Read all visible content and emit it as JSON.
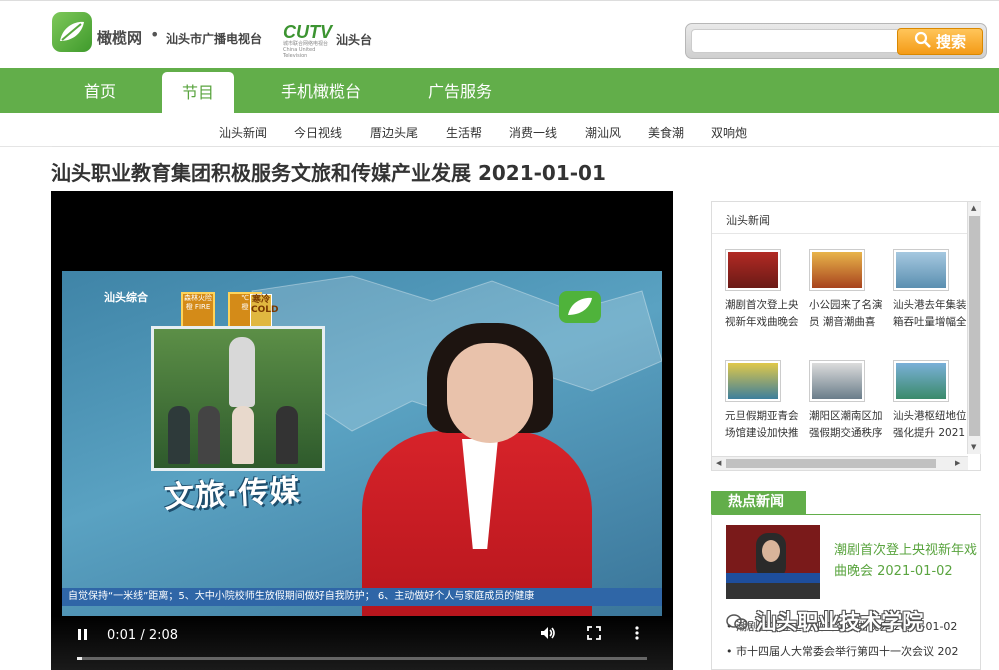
{
  "header": {
    "brand_name": "橄榄网",
    "brand_dot": "•",
    "station": "汕头市广播电视台",
    "cutv_logo": "CUTV",
    "cutv_sub": "城市联合网络电视台 China United Television",
    "cutv_city": "汕头台",
    "search_placeholder": "",
    "search_label": "搜索"
  },
  "nav": {
    "items": [
      {
        "label": "首页"
      },
      {
        "label": "节目"
      },
      {
        "label": "手机橄榄台"
      },
      {
        "label": "广告服务"
      }
    ],
    "active_index": 1
  },
  "subnav": {
    "items": [
      "汕头新闻",
      "今日视线",
      "厝边头尾",
      "生活帮",
      "消费一线",
      "潮汕风",
      "美食潮",
      "双响炮"
    ]
  },
  "page_title": "汕头职业教育集团积极服务文旅和传媒产业发展 2021-01-01",
  "video": {
    "channel": "汕头综合",
    "weather_1": "森林火险",
    "weather_1_sub": "橙 FIRE",
    "weather_2": "℃",
    "weather_2_sub": "橙",
    "weather_3": "寒冷",
    "weather_3_sub": "COLD",
    "caption": "文旅·传媒",
    "ticker": "自觉保持“一米线”距离；5、大中小院校师生放假期间做好自我防护；  6、主动做好个人与家庭成员的健康",
    "time": "0:01 / 2:08",
    "progress": 0.008
  },
  "news_box": {
    "title": "汕头新闻",
    "items": [
      {
        "caption": "潮剧首次登上央视新年戏曲晚会",
        "color": "#b22a24"
      },
      {
        "caption": "小公园来了名演员 潮音潮曲喜",
        "color": "#c8902c"
      },
      {
        "caption": "汕头港去年集装箱吞吐量增幅全",
        "color": "#5b8fb0"
      },
      {
        "caption": "元旦假期亚青会场馆建设加快推",
        "color": "#3d7f9c"
      },
      {
        "caption": "潮阳区潮南区加强假期交通秩序",
        "color": "#6a7d8a"
      },
      {
        "caption": "汕头港枢纽地位强化提升 2021",
        "color": "#3a8a6a"
      }
    ]
  },
  "hot_news": {
    "tab": "热点新闻",
    "feature_title": "潮剧首次登上央视新年戏曲晚会 2021-01-02",
    "rows": [
      "• 潮剧首次登上央视新年戏曲晚会 2021-01-02",
      "• 市十四届人大常委会举行第四十一次会议  202"
    ]
  },
  "watermark": "汕头职业技术学院"
}
